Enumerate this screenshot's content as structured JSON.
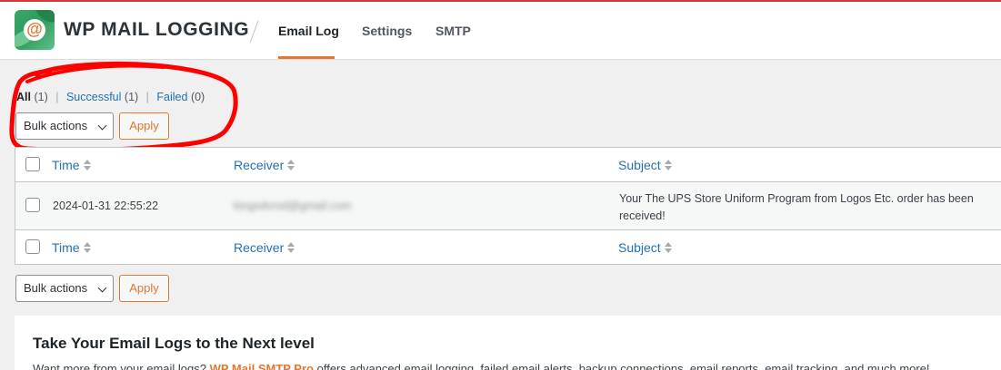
{
  "app": {
    "title": "WP MAIL LOGGING",
    "logo_glyph": "@",
    "accent_color": "#e27730",
    "link_color": "#2271b1"
  },
  "nav": {
    "tabs": [
      {
        "label": "Email Log",
        "active": true
      },
      {
        "label": "Settings",
        "active": false
      },
      {
        "label": "SMTP",
        "active": false
      }
    ]
  },
  "filters": {
    "all": {
      "label": "All",
      "count": "(1)"
    },
    "successful": {
      "label": "Successful",
      "count": "(1)"
    },
    "failed": {
      "label": "Failed",
      "count": "(0)"
    },
    "separator": "|"
  },
  "bulk_top": {
    "select_value": "Bulk actions",
    "apply_label": "Apply"
  },
  "bulk_bottom": {
    "select_value": "Bulk actions",
    "apply_label": "Apply"
  },
  "table": {
    "columns": [
      "Time",
      "Receiver",
      "Subject"
    ],
    "rows": [
      {
        "time": "2024-01-31 22:55:22",
        "receiver": "kingsdvrsd@gmail.com",
        "subject_line1": "Your The UPS Store Uniform Program from Logos Etc. order has been",
        "subject_line2": "received!"
      }
    ]
  },
  "promo": {
    "title": "Take Your Email Logs to the Next level",
    "text_before": "Want more from your email logs?",
    "link_text": "WP Mail SMTP Pro",
    "text_after": "offers advanced email logging, failed email alerts, backup connections, email reports, email tracking, and much more!"
  },
  "annotation": {
    "color": "#ff0000",
    "shape": "hand-drawn circle"
  }
}
